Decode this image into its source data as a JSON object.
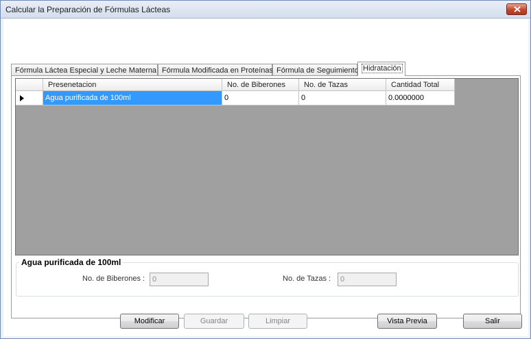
{
  "window": {
    "title": "Calcular la Preparación de Fórmulas Lácteas"
  },
  "tabs": [
    {
      "label": "Fórmula Láctea Especial y Leche Materna"
    },
    {
      "label": "Fórmula Modificada en Proteínas"
    },
    {
      "label": "Fórmula de Seguimiento"
    },
    {
      "label": "Hidratación",
      "active": true
    }
  ],
  "grid": {
    "columns": [
      "Presenetacion",
      "No. de Biberones",
      "No. de Tazas",
      "Cantidad Total"
    ],
    "rows": [
      {
        "presentacion": "Agua purificada de 100ml",
        "biberones": "0",
        "tazas": "0",
        "cantidad": "0.0000000"
      }
    ]
  },
  "details": {
    "group_title": "Agua purificada de 100ml",
    "biberones_label": "No. de Biberones :",
    "biberones_value": "0",
    "tazas_label": "No. de Tazas :",
    "tazas_value": "0"
  },
  "buttons": {
    "modificar": "Modificar",
    "guardar": "Guardar",
    "limpiar": "Limpiar",
    "vista_previa": "Vista Previa",
    "salir": "Salir"
  }
}
